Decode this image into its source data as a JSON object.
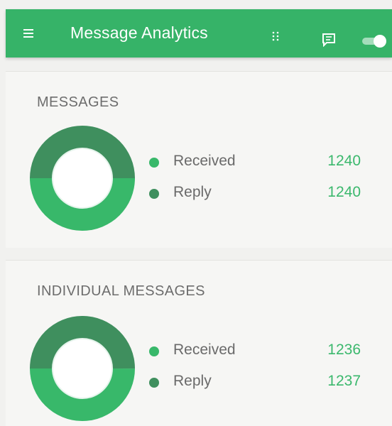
{
  "header": {
    "title": "Message Analytics",
    "icons": [
      "menu-icon",
      "grid-icon",
      "chat-icon",
      "toggle-switch"
    ],
    "background": "#36b368"
  },
  "colors": {
    "received": "#38b86a",
    "reply": "#3f8f5e",
    "value_text": "#3bb86d"
  },
  "cards": [
    {
      "title": "MESSAGES",
      "legend": [
        {
          "label": "Received",
          "value": "1240"
        },
        {
          "label": "Reply",
          "value": "1240"
        }
      ]
    },
    {
      "title": "INDIVIDUAL MESSAGES",
      "legend": [
        {
          "label": "Received",
          "value": "1236"
        },
        {
          "label": "Reply",
          "value": "1237"
        }
      ]
    }
  ],
  "chart_data": [
    {
      "type": "pie",
      "title": "MESSAGES",
      "categories": [
        "Received",
        "Reply"
      ],
      "values": [
        1240,
        1240
      ]
    },
    {
      "type": "pie",
      "title": "INDIVIDUAL MESSAGES",
      "categories": [
        "Received",
        "Reply"
      ],
      "values": [
        1236,
        1237
      ]
    }
  ]
}
